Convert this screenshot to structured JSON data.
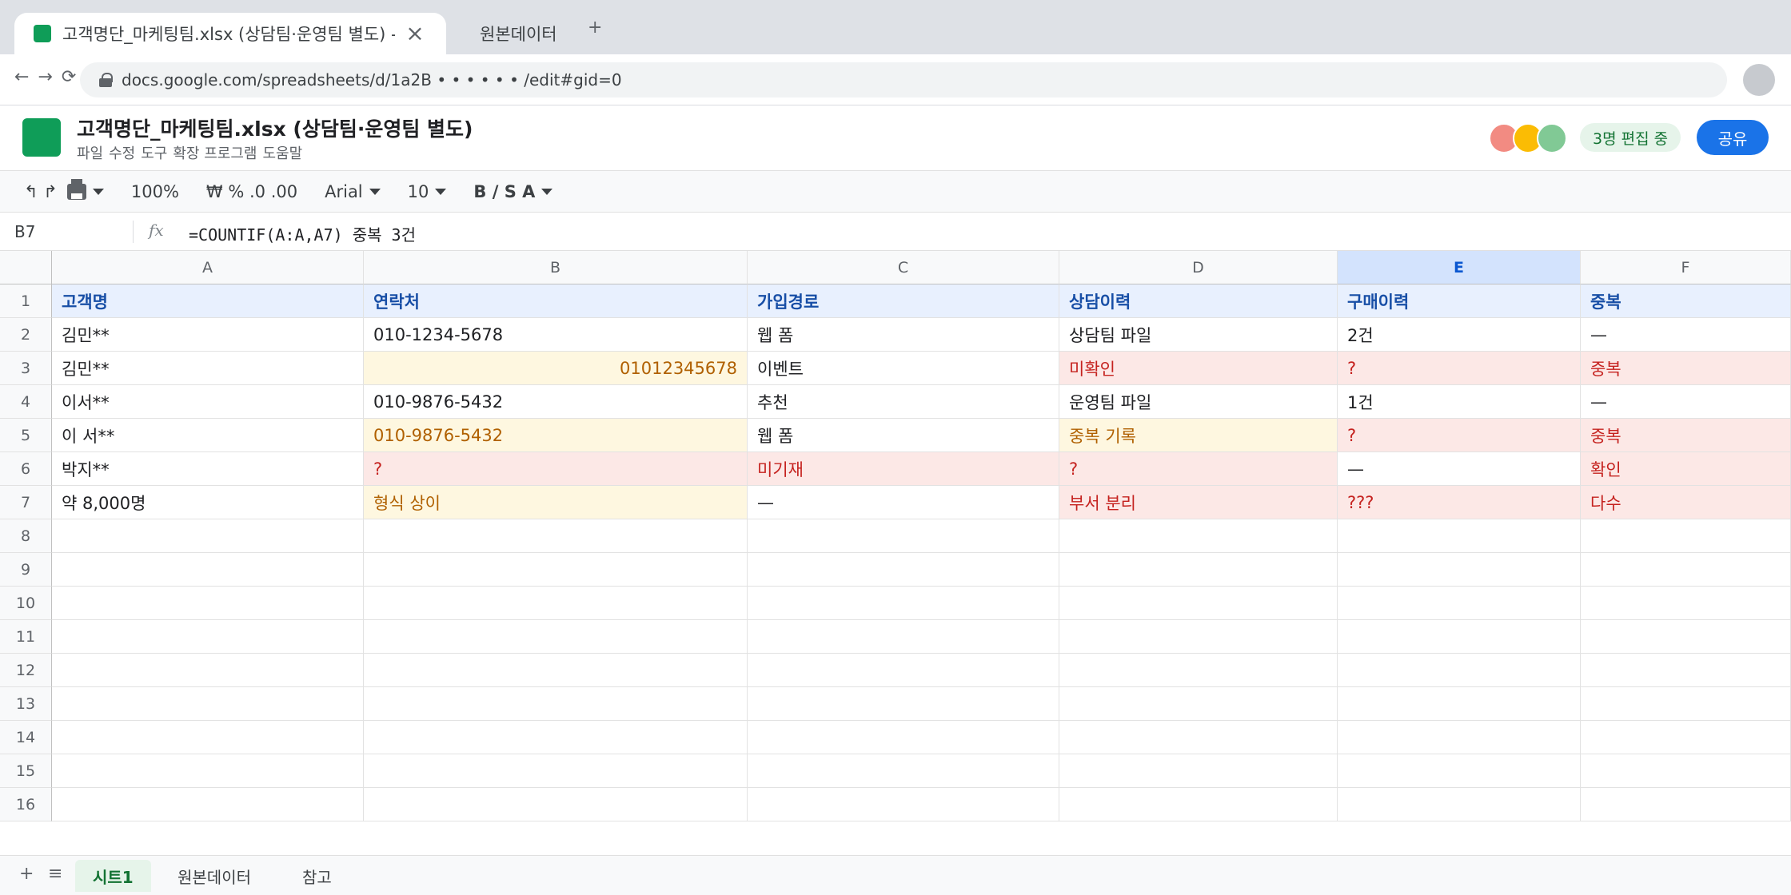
{
  "browser": {
    "active_tab_title": "고객명단_마케팅팀.xlsx (상담팀·운영팀 별도) - Google Sheets",
    "other_tab_title": "원본데이터",
    "new_tab_label": "+",
    "nav_controls": "← → ⟳",
    "url": "docs.google.com/spreadsheets/d/1a2B • • • • • • /edit#gid=0"
  },
  "doc": {
    "title": "고객명단_마케팅팀.xlsx (상담팀·운영팀 별도)",
    "menus": [
      "파일",
      "수정",
      "도구",
      "확장 프로그램",
      "도움말"
    ],
    "editing_badge": "3명 편집 중",
    "share_label": "공유",
    "collaborator_colors": [
      "#f28b82",
      "#fbbc04",
      "#81c995"
    ]
  },
  "toolbar": {
    "undo_redo": "↰ ↱",
    "zoom": "100%",
    "number_format": "₩ % .0 .00",
    "font": "Arial",
    "font_size": "10",
    "text_format": "B / S A"
  },
  "formula_bar": {
    "cell_ref": "B7",
    "fx_label": "fx",
    "formula": "=COUNTIF(A:A,A7) 중복 3건"
  },
  "grid": {
    "columns": [
      "A",
      "B",
      "C",
      "D",
      "E",
      "F"
    ],
    "selected_column": "E",
    "row_numbers": [
      "1",
      "2",
      "3",
      "4",
      "5",
      "6",
      "7",
      "8",
      "9",
      "10",
      "11",
      "12",
      "13",
      "14",
      "15",
      "16"
    ],
    "rows": [
      [
        {
          "v": "고객명",
          "s": "hdr"
        },
        {
          "v": "연락처",
          "s": "hdr"
        },
        {
          "v": "가입경로",
          "s": "hdr"
        },
        {
          "v": "상담이력",
          "s": "hdr"
        },
        {
          "v": "구매이력",
          "s": "hdr"
        },
        {
          "v": "중복",
          "s": "hdr"
        }
      ],
      [
        {
          "v": "김민**"
        },
        {
          "v": "010-1234-5678"
        },
        {
          "v": "웹 폼"
        },
        {
          "v": "상담팀 파일"
        },
        {
          "v": "2건"
        },
        {
          "v": "—"
        }
      ],
      [
        {
          "v": "김민**"
        },
        {
          "v": "01012345678",
          "s": "warn right"
        },
        {
          "v": "이벤트"
        },
        {
          "v": "미확인",
          "s": "err"
        },
        {
          "v": "?",
          "s": "err"
        },
        {
          "v": "중복",
          "s": "err"
        }
      ],
      [
        {
          "v": "이서**"
        },
        {
          "v": "010-9876-5432"
        },
        {
          "v": "추천"
        },
        {
          "v": "운영팀 파일"
        },
        {
          "v": "1건"
        },
        {
          "v": "—"
        }
      ],
      [
        {
          "v": "이 서**"
        },
        {
          "v": "010-9876-5432",
          "s": "warn"
        },
        {
          "v": "웹 폼"
        },
        {
          "v": "중복 기록",
          "s": "warn"
        },
        {
          "v": "?",
          "s": "err"
        },
        {
          "v": "중복",
          "s": "err"
        }
      ],
      [
        {
          "v": "박지**"
        },
        {
          "v": "?",
          "s": "err"
        },
        {
          "v": "미기재",
          "s": "err"
        },
        {
          "v": "?",
          "s": "err"
        },
        {
          "v": "—"
        },
        {
          "v": "확인",
          "s": "err"
        }
      ],
      [
        {
          "v": "약 8,000명"
        },
        {
          "v": "형식 상이",
          "s": "warn"
        },
        {
          "v": "—"
        },
        {
          "v": "부서 분리",
          "s": "err"
        },
        {
          "v": "???",
          "s": "err"
        },
        {
          "v": "다수",
          "s": "err"
        }
      ]
    ]
  },
  "sheets": {
    "add_label": "+",
    "menu_label": "≡",
    "tabs": [
      "시트1",
      "원본데이터",
      "참고"
    ],
    "active_index": 0
  }
}
